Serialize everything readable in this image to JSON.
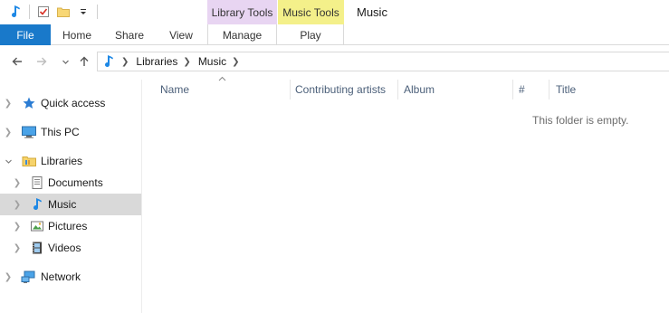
{
  "window": {
    "title": "Music"
  },
  "quick_access_toolbar": {
    "icons": [
      "music-library-icon",
      "properties-icon",
      "new-folder-icon",
      "customize-qat-icon"
    ]
  },
  "contextual_tabs": {
    "library_tools": "Library Tools",
    "music_tools": "Music Tools"
  },
  "ribbon_tabs": {
    "file": "File",
    "home": "Home",
    "share": "Share",
    "view": "View",
    "manage": "Manage",
    "play": "Play"
  },
  "address_bar": {
    "breadcrumbs": [
      "Libraries",
      "Music"
    ]
  },
  "nav_pane": {
    "items": [
      {
        "label": "Quick access",
        "icon": "star-icon"
      },
      {
        "label": "This PC",
        "icon": "computer-icon"
      },
      {
        "label": "Libraries",
        "icon": "libraries-folder-icon"
      },
      {
        "label": "Documents",
        "icon": "documents-icon"
      },
      {
        "label": "Music",
        "icon": "music-icon",
        "selected": true
      },
      {
        "label": "Pictures",
        "icon": "pictures-icon"
      },
      {
        "label": "Videos",
        "icon": "videos-icon"
      },
      {
        "label": "Network",
        "icon": "network-icon"
      }
    ]
  },
  "columns": {
    "name": "Name",
    "artists": "Contributing artists",
    "album": "Album",
    "number": "#",
    "title": "Title"
  },
  "content": {
    "empty_message": "This folder is empty."
  },
  "colors": {
    "file_tab": "#1979ca",
    "library_tools": "#e8d5f2",
    "music_tools": "#f4f08a",
    "selected": "#d9d9d9"
  }
}
